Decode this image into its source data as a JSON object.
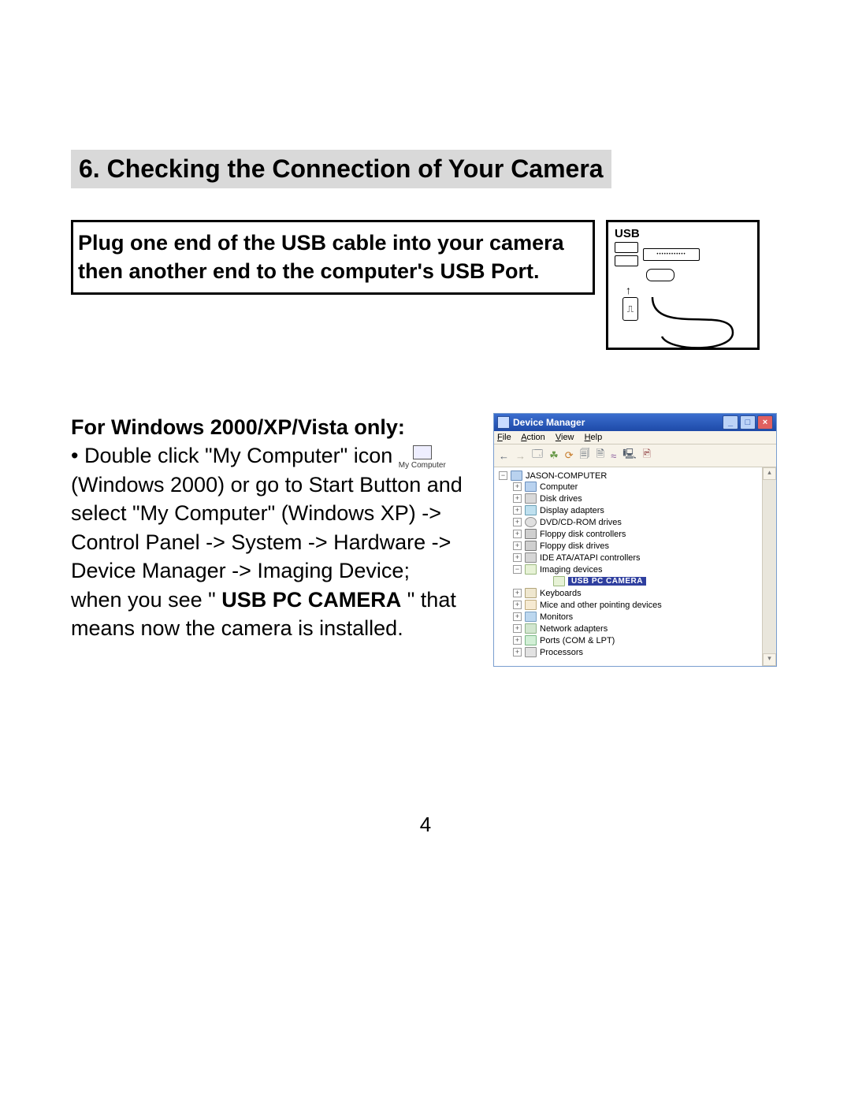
{
  "section_title": "6. Checking the Connection of Your Camera",
  "instruction_box": "Plug one end of the USB cable into your camera then another end to the computer's USB Port.",
  "usb_diagram": {
    "label": "USB"
  },
  "body": {
    "sub_heading": "For Windows 2000/XP/Vista only:",
    "line1_prefix": "• Double click \"My Computer\" icon ",
    "my_computer_icon_label": "My Computer",
    "para_rest_pre": "(Windows 2000) or go to Start Button and select \"My Computer\" (Windows XP) -> Control Panel -> System -> Hardware -> Device Manager -> Imaging Device; when you see \" ",
    "usb_pc_camera": "USB PC CAMERA",
    "para_rest_post": " \" that means now the camera is installed."
  },
  "device_manager": {
    "title": "Device Manager",
    "menu": {
      "file": "File",
      "action": "Action",
      "view": "View",
      "help": "Help"
    },
    "root": "JASON-COMPUTER",
    "nodes": {
      "computer": "Computer",
      "disk_drives": "Disk drives",
      "display_adapters": "Display adapters",
      "dvd_cdrom": "DVD/CD-ROM drives",
      "floppy_ctrl": "Floppy disk controllers",
      "floppy_drives": "Floppy disk drives",
      "ide": "IDE ATA/ATAPI controllers",
      "imaging": "Imaging devices",
      "imaging_child": "USB PC CAMERA",
      "keyboards": "Keyboards",
      "mice": "Mice and other pointing devices",
      "monitors": "Monitors",
      "network": "Network adapters",
      "ports": "Ports (COM & LPT)",
      "processors": "Processors"
    }
  },
  "page_number": "4"
}
